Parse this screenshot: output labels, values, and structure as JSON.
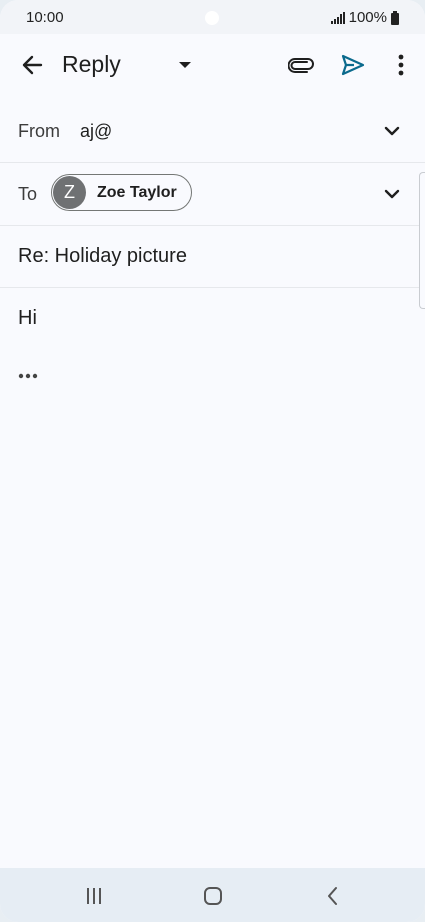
{
  "status_bar": {
    "time": "10:00",
    "battery": "100%"
  },
  "toolbar": {
    "title": "Reply",
    "icons": [
      "back-arrow-icon",
      "dropdown-arrow-icon",
      "attach-icon",
      "send-icon",
      "more-vert-icon"
    ],
    "send_color": "#0b6a8d"
  },
  "compose": {
    "from_label": "From",
    "from_value": "aj@",
    "to_label": "To",
    "recipient": {
      "initial": "Z",
      "name": "Zoe Taylor"
    },
    "subject": "Re: Holiday picture",
    "body": "Hi"
  },
  "nav_bar": {
    "icons": [
      "recents-icon",
      "home-icon",
      "back-icon"
    ]
  }
}
